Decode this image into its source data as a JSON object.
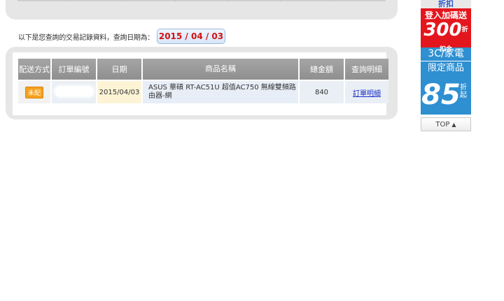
{
  "query": {
    "label": "以下是您查詢的交易記錄資料，查詢日期為：",
    "date": "2015 / 04 / 03"
  },
  "table": {
    "headers": [
      "配送方式",
      "訂單編號",
      "日期",
      "商品名稱",
      "總金額",
      "查詢明細"
    ],
    "rows": [
      {
        "ship_badge": "未配",
        "date": "2015/04/03",
        "product": "ASUS 華碩 RT-AC51U 超值AC750 無線雙頻路由器-網",
        "total": "840",
        "detail": "訂單明細"
      }
    ]
  },
  "ads": {
    "a1": "折扣",
    "a2_line1": "登入加碼送",
    "a2_num": "300",
    "a2_unit": "折扣金",
    "a3_line1": "3C/家電",
    "a3_line2": "限定商品",
    "a4_num": "85",
    "a4_unit": "折起",
    "top_label": "TOP"
  },
  "colors": {
    "date_text": "#d31212",
    "header_bg": "#999999",
    "link": "#1a2fc9",
    "badge": "#f4a21c",
    "ad_red": "#e4161d",
    "ad_blue": "#2e8fd1"
  }
}
